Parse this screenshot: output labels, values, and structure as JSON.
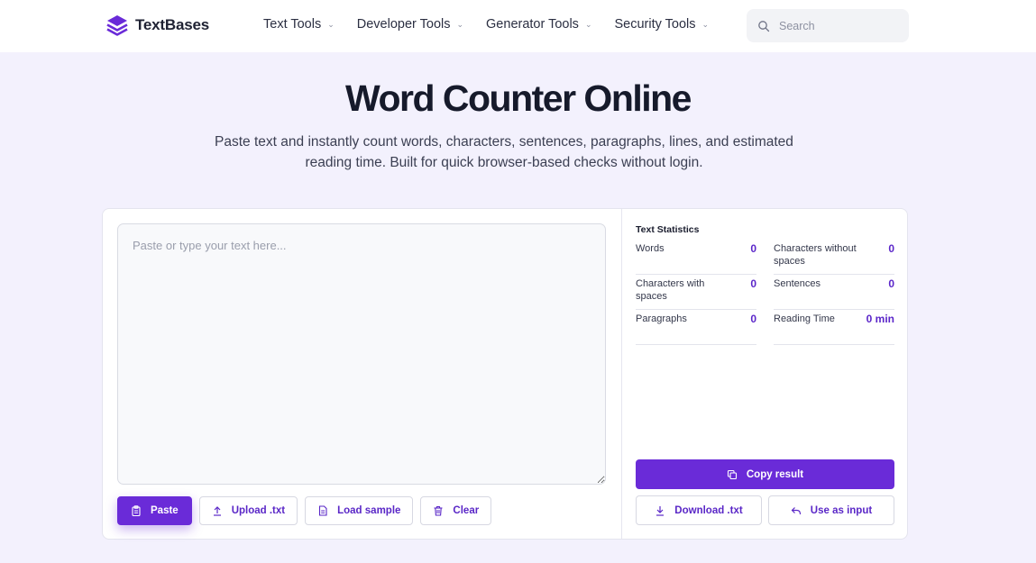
{
  "brand": {
    "name": "TextBases",
    "color": "#6a2bd8"
  },
  "nav": {
    "items": [
      {
        "label": "Text Tools"
      },
      {
        "label": "Developer Tools"
      },
      {
        "label": "Generator Tools"
      },
      {
        "label": "Security Tools"
      }
    ]
  },
  "search": {
    "placeholder": "Search"
  },
  "hero": {
    "title": "Word Counter Online",
    "subtitle": "Paste text and instantly count words, characters, sentences, paragraphs, lines, and estimated reading time. Built for quick browser-based checks without login."
  },
  "editor": {
    "placeholder": "Paste or type your text here...",
    "value": "",
    "buttons": {
      "paste": "Paste",
      "upload": "Upload .txt",
      "sample": "Load sample",
      "clear": "Clear"
    }
  },
  "stats": {
    "title": "Text Statistics",
    "items": [
      {
        "label": "Words",
        "value": "0"
      },
      {
        "label": "Characters without spaces",
        "value": "0"
      },
      {
        "label": "Characters with spaces",
        "value": "0"
      },
      {
        "label": "Sentences",
        "value": "0"
      },
      {
        "label": "Paragraphs",
        "value": "0"
      },
      {
        "label": "Reading Time",
        "value": "0 min"
      }
    ]
  },
  "output": {
    "copy": "Copy result",
    "download": "Download .txt",
    "use_input": "Use as input"
  }
}
